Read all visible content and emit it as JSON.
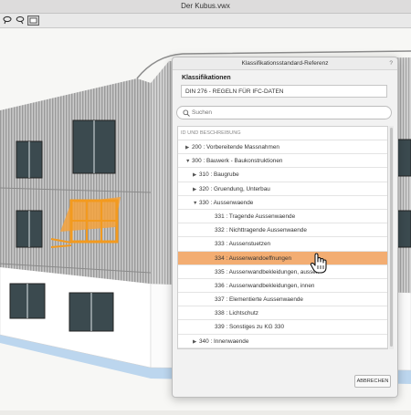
{
  "window": {
    "title": "Der Kubus.vwx"
  },
  "toolbar": {
    "icons": [
      "lasso-select-icon",
      "pan-icon",
      "view-icon"
    ]
  },
  "dialog": {
    "title": "Klassifikationsstandard-Referenz",
    "help": "?",
    "section_label": "Klassifikationen",
    "selected_standard": "DIN 276 - REGELN FÜR IFC-DATEN",
    "search_placeholder": "Suchen",
    "list_header": "ID UND BESCHREIBUNG",
    "rows": [
      {
        "label": "200 : Vorbereitende Massnahmen",
        "level": 0,
        "state": "collapsed"
      },
      {
        "label": "300 : Bauwerk - Baukonstruktionen",
        "level": 0,
        "state": "expanded"
      },
      {
        "label": "310 : Baugrube",
        "level": 1,
        "state": "collapsed"
      },
      {
        "label": "320 : Gruendung, Unterbau",
        "level": 1,
        "state": "collapsed"
      },
      {
        "label": "330 : Aussenwaende",
        "level": 1,
        "state": "expanded"
      },
      {
        "label": "331 : Tragende Aussenwaende",
        "level": 2,
        "state": "leaf"
      },
      {
        "label": "332 : Nichttragende Aussenwaende",
        "level": 2,
        "state": "leaf"
      },
      {
        "label": "333 : Aussenstuetzen",
        "level": 2,
        "state": "leaf"
      },
      {
        "label": "334 : Aussenwandoeffnungen",
        "level": 2,
        "state": "leaf",
        "selected": true
      },
      {
        "label": "335 : Aussenwandbekleidungen, aussen",
        "level": 2,
        "state": "leaf"
      },
      {
        "label": "336 : Aussenwandbekleidungen, innen",
        "level": 2,
        "state": "leaf"
      },
      {
        "label": "337 : Elementierte Aussenwaende",
        "level": 2,
        "state": "leaf"
      },
      {
        "label": "338 : Lichtschutz",
        "level": 2,
        "state": "leaf"
      },
      {
        "label": "339 : Sonstiges zu KG 330",
        "level": 2,
        "state": "leaf"
      },
      {
        "label": "340 : Innenwaende",
        "level": 1,
        "state": "collapsed"
      }
    ],
    "cancel_label": "ABBRECHEN"
  },
  "colors": {
    "selection": "#f3ad72",
    "highlight": "#f39a1e",
    "ground": "#bcd6ee"
  }
}
